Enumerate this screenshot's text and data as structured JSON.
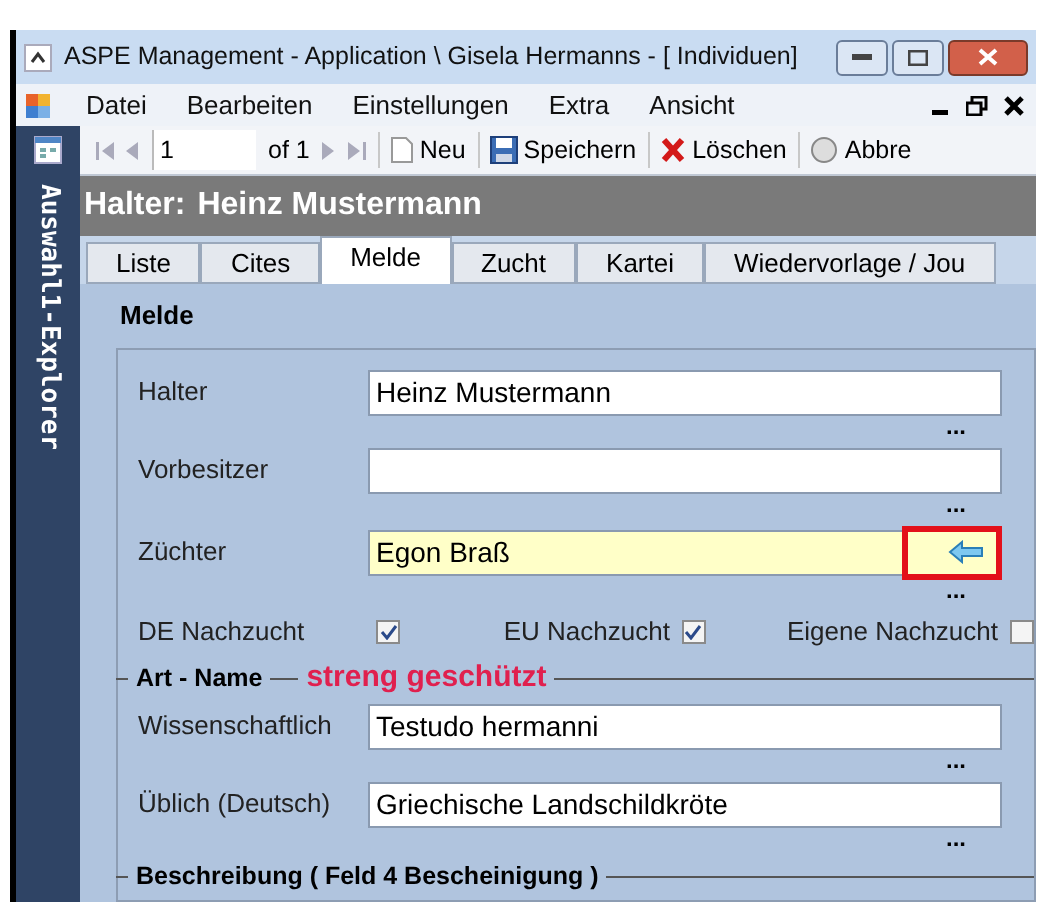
{
  "window": {
    "title": "ASPE Management - Application \\ Gisela Hermanns - [ Individuen]"
  },
  "menu": {
    "items": [
      "Datei",
      "Bearbeiten",
      "Einstellungen",
      "Extra",
      "Ansicht"
    ]
  },
  "toolbar": {
    "record": "1",
    "of": "of 1",
    "buttons": [
      {
        "kind": "new",
        "label": "Neu"
      },
      {
        "kind": "save",
        "label": "Speichern"
      },
      {
        "kind": "delete",
        "label": "Löschen"
      },
      {
        "kind": "cancel",
        "label": "Abbre"
      }
    ]
  },
  "sidebar": {
    "title": "Auswahl1-Explorer"
  },
  "header": {
    "label": "Halter:",
    "name": "Heinz Mustermann"
  },
  "tabs": [
    {
      "label": "Liste",
      "selected": false
    },
    {
      "label": "Cites",
      "selected": false
    },
    {
      "label": "Melde",
      "selected": true
    },
    {
      "label": "Zucht",
      "selected": false
    },
    {
      "label": "Kartei",
      "selected": false
    },
    {
      "label": "Wiedervorlage / Jou",
      "selected": false
    }
  ],
  "section": {
    "title": "Melde"
  },
  "owner_fields": [
    {
      "label": "Halter",
      "value": "Heinz Mustermann",
      "highlighted": false,
      "more": "..."
    },
    {
      "label": "Vorbesitzer",
      "highlighted": false,
      "more": "..."
    },
    {
      "label": "Züchter",
      "value": "Egon Braß",
      "highlighted": true,
      "more": "..."
    }
  ],
  "checkboxes": [
    {
      "label": "DE Nachzucht",
      "checked": true
    },
    {
      "label": "EU Nachzucht",
      "checked": true
    },
    {
      "label": "Eigene Nachzucht",
      "checked": false
    }
  ],
  "species_group": {
    "title": "Art - Name",
    "status": "streng geschützt",
    "fields": [
      {
        "label": "Wissenschaftlich",
        "value": "Testudo hermanni",
        "highlighted": false,
        "more": "..."
      },
      {
        "label": "Üblich (Deutsch)",
        "value": "Griechische Landschildkröte",
        "highlighted": false,
        "more": "..."
      }
    ]
  },
  "description_group": {
    "title": "Beschreibung ( Feld 4 Bescheinigung )"
  }
}
